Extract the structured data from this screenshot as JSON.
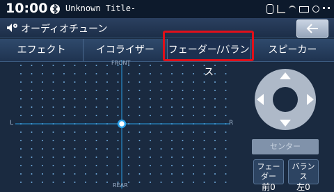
{
  "status": {
    "time": "10:00",
    "track_title": "Unknown Title-"
  },
  "header": {
    "title": "オーディオチューン"
  },
  "tabs": [
    {
      "label": "エフェクト"
    },
    {
      "label": "イコライザー"
    },
    {
      "label": "フェーダー/バランス"
    },
    {
      "label": "スピーカー"
    }
  ],
  "field": {
    "front_label": "FRONT",
    "rear_label": "REAR",
    "left_label": "L",
    "right_label": "R"
  },
  "controls": {
    "center_label": "センター",
    "fader_label": "フェーダー",
    "fader_value": "前0",
    "balance_label": "バランス",
    "balance_value": "左0"
  },
  "colors": {
    "accent": "#2aa0e8",
    "highlight": "#e0101a"
  }
}
